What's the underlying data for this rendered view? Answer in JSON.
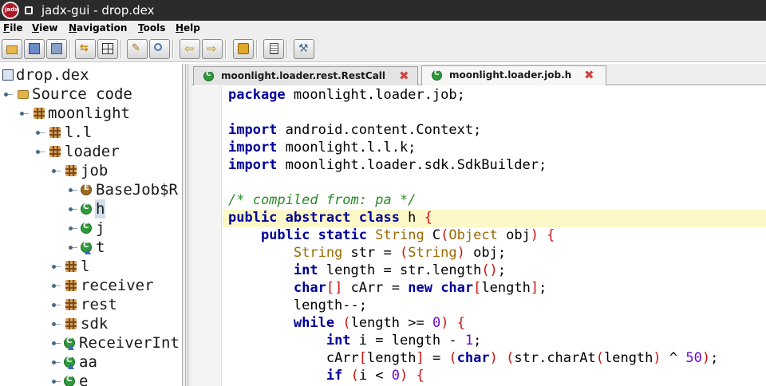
{
  "window": {
    "title": "jadx-gui - drop.dex",
    "logo_text": "jadx"
  },
  "menu": [
    "File",
    "View",
    "Navigation",
    "Tools",
    "Help"
  ],
  "toolbar": {
    "buttons": [
      "open-file",
      "save-all",
      "export",
      "sync-with-editor",
      "flatten-packages",
      "search",
      "find-class",
      "back",
      "forward",
      "decompile-all",
      "log-viewer",
      "preferences"
    ]
  },
  "tree": {
    "root": "drop.dex",
    "source_code": "Source code",
    "moonlight": "moonlight",
    "ll": "l.l",
    "loader": "loader",
    "job": "job",
    "basejob": "BaseJob$R",
    "h": "h",
    "j": "j",
    "t": "t",
    "l": "l",
    "receiver": "receiver",
    "rest": "rest",
    "sdk": "sdk",
    "receiverint": "ReceiverInt",
    "aa": "aa",
    "e": "e"
  },
  "tabs": [
    {
      "label": "moonlight.loader.rest.RestCall",
      "active": false
    },
    {
      "label": "moonlight.loader.job.h",
      "active": true
    }
  ],
  "code": {
    "l1_kw": "package",
    "l1_rest": " moonlight.loader.job;",
    "l3_kw": "import",
    "l3_rest": " android.content.Context;",
    "l4_kw": "import",
    "l4_rest": " moonlight.l.l.k;",
    "l5_kw": "import",
    "l5_rest": " moonlight.loader.sdk.SdkBuilder;",
    "l7_comment": "/* compiled from: pa */",
    "l8_kw": "public abstract class",
    "l8_rest": " h ",
    "l8_brace": "{",
    "l9_indent": "    ",
    "l9_kw": "public static",
    "l9_sp": " ",
    "l9_type": "String",
    "l9_mid": " C",
    "l9_p1": "(",
    "l9_type2": "Object",
    "l9_obj": " obj",
    "l9_p2": ")",
    "l9_sp2": " ",
    "l9_brace": "{",
    "l10_indent": "        ",
    "l10_type": "String",
    "l10_mid": " str = ",
    "l10_p1": "(",
    "l10_type2": "String",
    "l10_p2": ")",
    "l10_rest": " obj;",
    "l11_indent": "        ",
    "l11_kw": "int",
    "l11_mid": " length = str.length",
    "l11_paren": "()",
    "l11_end": ";",
    "l12_indent": "        ",
    "l12_kw": "char",
    "l12_br": "[]",
    "l12_mid": " cArr = ",
    "l12_kw2": "new",
    "l12_sp": " ",
    "l12_kw3": "char",
    "l12_b1": "[",
    "l12_len": "length",
    "l12_b2": "]",
    "l12_end": ";",
    "l13": "        length--;",
    "l14_indent": "        ",
    "l14_kw": "while",
    "l14_sp": " ",
    "l14_p1": "(",
    "l14_mid": "length >= ",
    "l14_num": "0",
    "l14_p2": ")",
    "l14_sp2": " ",
    "l14_brace": "{",
    "l15_indent": "            ",
    "l15_kw": "int",
    "l15_mid": " i = length - ",
    "l15_num": "1",
    "l15_end": ";",
    "l16_indent": "            ",
    "l16_a": "cArr",
    "l16_b1": "[",
    "l16_len": "length",
    "l16_b2": "]",
    "l16_eq": " = ",
    "l16_p1": "(",
    "l16_kw": "char",
    "l16_p2": ")",
    "l16_sp": " ",
    "l16_p3": "(",
    "l16_mid": "str.charAt",
    "l16_p4": "(",
    "l16_len2": "length",
    "l16_p5": ")",
    "l16_xor": " ^ ",
    "l16_num": "50",
    "l16_p6": ")",
    "l16_end": ";",
    "l17_indent": "            ",
    "l17_kw": "if",
    "l17_sp": " ",
    "l17_p1": "(",
    "l17_mid": "i < ",
    "l17_num": "0",
    "l17_p2": ")",
    "l17_sp2": " ",
    "l17_brace": "{"
  }
}
